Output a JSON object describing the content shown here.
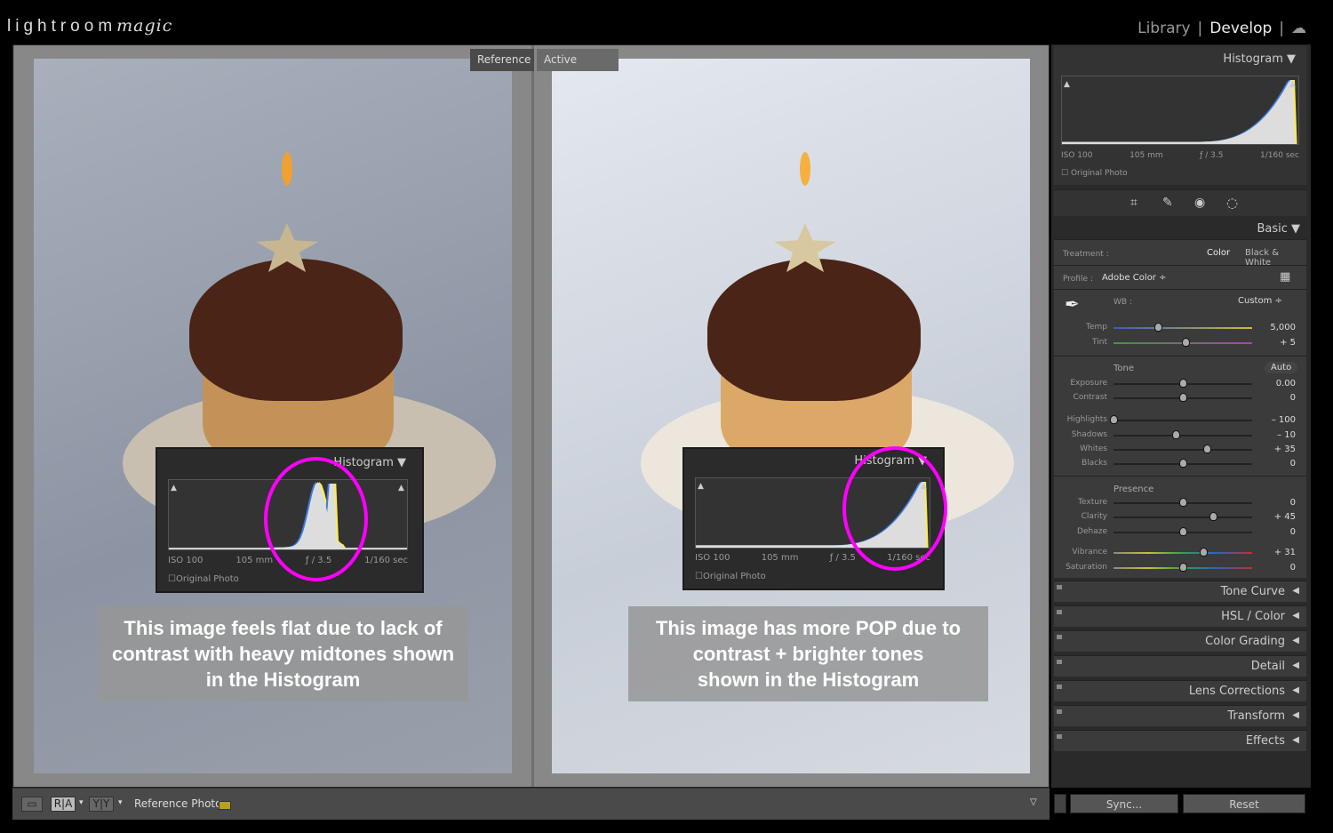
{
  "app": {
    "logo": "lightroom",
    "logo_script": "magic",
    "modules": [
      "Library",
      "Develop"
    ],
    "active_module": "Develop"
  },
  "compare": {
    "reference_label": "Reference",
    "active_label": "Active",
    "left_caption": [
      "This image feels flat due to lack of",
      "contrast with heavy midtones shown",
      "in the Histogram"
    ],
    "right_caption": [
      "This image has more POP due to",
      "contrast + brighter tones",
      "shown in the Histogram"
    ],
    "highlight_color": "#ff00ff"
  },
  "histogram": {
    "title": "Histogram",
    "iso": "ISO 100",
    "focal": "105 mm",
    "aperture": "ƒ / 3.5",
    "shutter": "1/160 sec",
    "original_photo": "Original Photo"
  },
  "toolbar": {
    "ra": "R|A",
    "yy": "Y|Y",
    "reference_photo": "Reference Photo :"
  },
  "sidebar": {
    "histogram_title": "Histogram",
    "tools": [
      "crop-icon",
      "healing-icon",
      "red-eye-icon",
      "mask-icon"
    ],
    "basic_title": "Basic",
    "treatment_label": "Treatment :",
    "treatment_color": "Color",
    "treatment_bw": "Black & White",
    "profile_label": "Profile :",
    "profile_value": "Adobe Color",
    "wb_label": "WB :",
    "wb_value": "Custom",
    "tone_label": "Tone",
    "auto_label": "Auto",
    "presence_label": "Presence",
    "sliders": [
      {
        "name": "Temp",
        "value": "5,000",
        "level": 0.32,
        "track": "temp"
      },
      {
        "name": "Tint",
        "value": "+ 5",
        "level": 0.52,
        "track": "tint"
      },
      {
        "name": "Exposure",
        "value": "0.00",
        "level": 0.5
      },
      {
        "name": "Contrast",
        "value": "0",
        "level": 0.5
      },
      {
        "name": "Highlights",
        "value": "– 100",
        "level": 0.0
      },
      {
        "name": "Shadows",
        "value": "– 10",
        "level": 0.45
      },
      {
        "name": "Whites",
        "value": "+ 35",
        "level": 0.67
      },
      {
        "name": "Blacks",
        "value": "0",
        "level": 0.5
      },
      {
        "name": "Texture",
        "value": "0",
        "level": 0.5
      },
      {
        "name": "Clarity",
        "value": "+ 45",
        "level": 0.72
      },
      {
        "name": "Dehaze",
        "value": "0",
        "level": 0.5
      },
      {
        "name": "Vibrance",
        "value": "+ 31",
        "level": 0.65,
        "track": "vib"
      },
      {
        "name": "Saturation",
        "value": "0",
        "level": 0.5,
        "track": "vib"
      }
    ],
    "panels": [
      "Tone Curve",
      "HSL / Color",
      "Color Grading",
      "Detail",
      "Lens Corrections",
      "Transform",
      "Effects"
    ],
    "sync_label": "Sync...",
    "reset_label": "Reset"
  }
}
